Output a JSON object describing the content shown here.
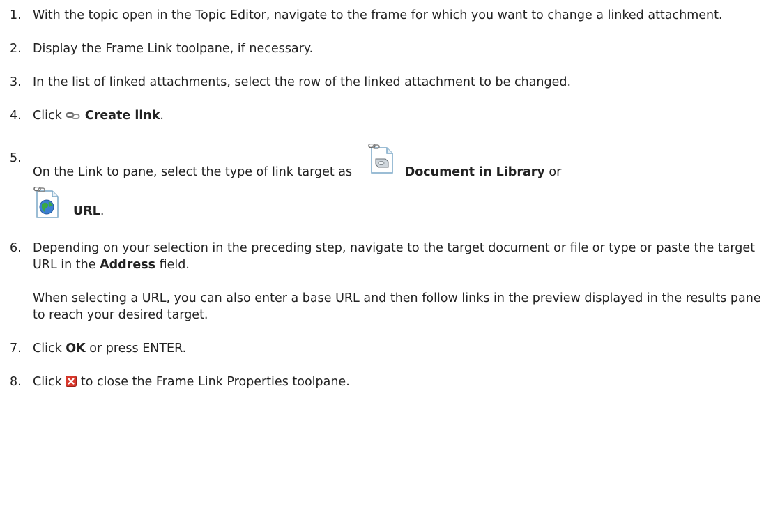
{
  "steps": [
    {
      "num": "1.",
      "text": "With the topic open in the Topic Editor, navigate to the frame for which you want to change a linked attachment."
    },
    {
      "num": "2.",
      "text": "Display the Frame Link toolpane, if necessary."
    },
    {
      "num": "3.",
      "text": "In the list of linked attachments, select the row of the linked attachment to be changed."
    },
    {
      "num": "4.",
      "pre": "Click ",
      "bold": "Create link",
      "post": ".",
      "icon": "link-chain-icon"
    },
    {
      "num": "5.",
      "pre": "On the Link to pane, select the type of link target as ",
      "bold1": "Document in Library",
      "mid": " or",
      "bold2": "URL",
      "post": ".",
      "icon1": "document-in-library-icon",
      "icon2": "url-globe-icon"
    },
    {
      "num": "6.",
      "pre": "Depending on your selection in the preceding step, navigate to the target document or file or type or paste the target URL in the ",
      "bold": "Address",
      "post": " field.",
      "note": "When selecting a URL, you can also enter a base URL and then follow links in the preview displayed in the results pane to reach your desired target."
    },
    {
      "num": "7.",
      "pre": "Click ",
      "bold": "OK",
      "post": " or press ENTER."
    },
    {
      "num": "8.",
      "pre": "Click ",
      "post": " to close the Frame Link Properties toolpane.",
      "icon": "close-x-icon"
    }
  ]
}
